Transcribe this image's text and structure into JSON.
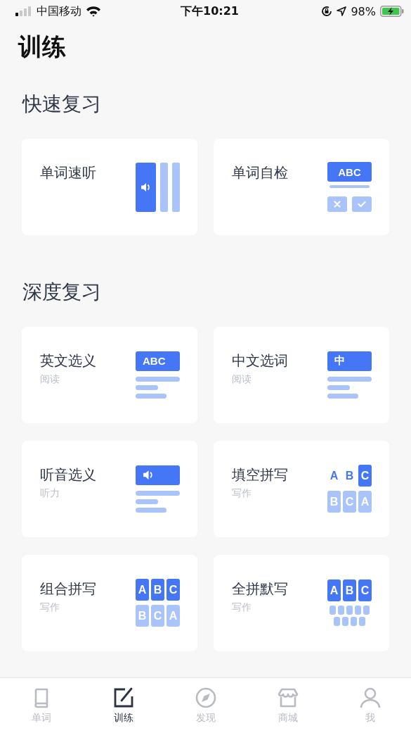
{
  "status_bar": {
    "carrier": "中国移动",
    "time": "下午10:21",
    "battery": "98%"
  },
  "title": "训练",
  "sections": [
    {
      "heading": "快速复习",
      "cards": [
        {
          "title": "单词速听",
          "illustration": {
            "kind": "speaker-bars"
          }
        },
        {
          "title": "单词自检",
          "illustration": {
            "kind": "word-check",
            "label": "ABC"
          }
        }
      ]
    },
    {
      "heading": "深度复习",
      "cards": [
        {
          "title": "英文选义",
          "subtitle": "阅读",
          "illustration": {
            "kind": "banner",
            "label": "ABC"
          }
        },
        {
          "title": "中文选词",
          "subtitle": "阅读",
          "illustration": {
            "kind": "banner",
            "label": "中"
          }
        },
        {
          "title": "听音选义",
          "subtitle": "听力",
          "illustration": {
            "kind": "banner-speaker"
          }
        },
        {
          "title": "填空拼写",
          "subtitle": "写作",
          "illustration": {
            "kind": "letters",
            "top": [
              {
                "text": "A",
                "filled": false
              },
              {
                "text": "B",
                "filled": false
              },
              {
                "text": "C",
                "filled": true
              }
            ],
            "bottom": [
              "B",
              "C",
              "A"
            ]
          }
        },
        {
          "title": "组合拼写",
          "subtitle": "写作",
          "illustration": {
            "kind": "letters",
            "top": [
              {
                "text": "A",
                "filled": true
              },
              {
                "text": "B",
                "filled": true
              },
              {
                "text": "C",
                "filled": true
              }
            ],
            "bottom": [
              "B",
              "C",
              "A"
            ]
          }
        },
        {
          "title": "全拼默写",
          "subtitle": "写作",
          "illustration": {
            "kind": "keyboard",
            "top": [
              "A",
              "B",
              "C"
            ]
          }
        }
      ]
    }
  ],
  "tabs": [
    {
      "label": "单词",
      "selected": false
    },
    {
      "label": "训练",
      "selected": true
    },
    {
      "label": "发现",
      "selected": false
    },
    {
      "label": "商城",
      "selected": false
    },
    {
      "label": "我",
      "selected": false
    }
  ]
}
